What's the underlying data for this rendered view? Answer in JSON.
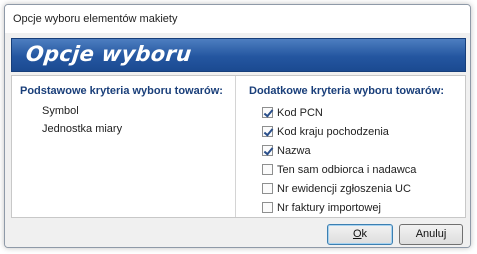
{
  "window": {
    "title": "Opcje wyboru elementów makiety"
  },
  "banner": {
    "text": "Opcje wyboru"
  },
  "left_panel": {
    "heading": "Podstawowe kryteria wyboru towarów:",
    "items": [
      "Symbol",
      "Jednostka miary"
    ]
  },
  "right_panel": {
    "heading": "Dodatkowe kryteria wyboru towarów:",
    "options": [
      {
        "label": "Kod PCN",
        "checked": true
      },
      {
        "label": "Kod kraju pochodzenia",
        "checked": true
      },
      {
        "label": "Nazwa",
        "checked": true
      },
      {
        "label": "Ten sam odbiorca i nadawca",
        "checked": false
      },
      {
        "label": "Nr ewidencji zgłoszenia UC",
        "checked": false
      },
      {
        "label": "Nr faktury importowej",
        "checked": false
      }
    ]
  },
  "buttons": {
    "ok_mnemonic": "O",
    "ok_rest": "k",
    "cancel": "Anuluj"
  },
  "colors": {
    "banner": "#2456a0",
    "heading": "#1a3f7a"
  }
}
